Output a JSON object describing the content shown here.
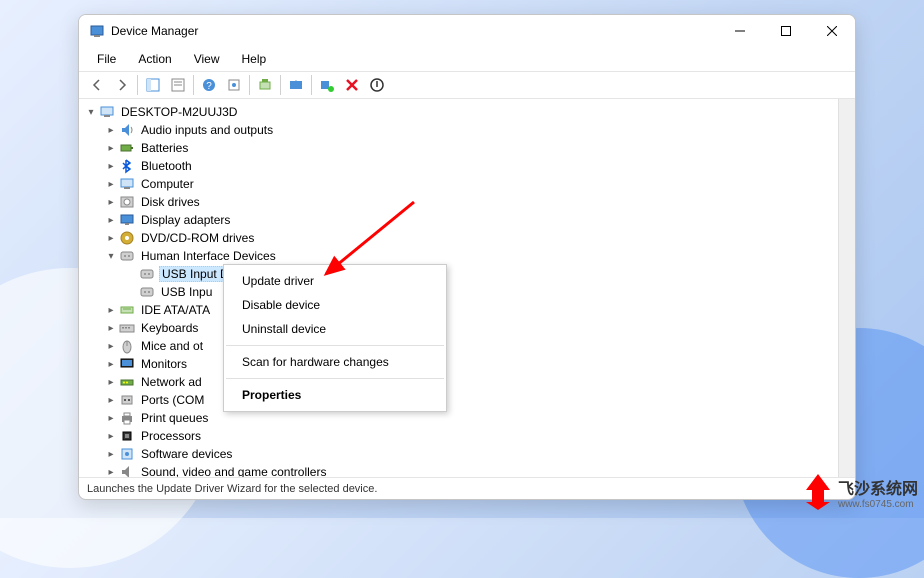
{
  "window": {
    "title": "Device Manager"
  },
  "menu": {
    "file": "File",
    "action": "Action",
    "view": "View",
    "help": "Help"
  },
  "tree": {
    "root": "DESKTOP-M2UUJ3D",
    "items": [
      {
        "label": "Audio inputs and outputs",
        "arrow": "right",
        "indent": 1,
        "icon": "audio"
      },
      {
        "label": "Batteries",
        "arrow": "right",
        "indent": 1,
        "icon": "battery"
      },
      {
        "label": "Bluetooth",
        "arrow": "right",
        "indent": 1,
        "icon": "bluetooth"
      },
      {
        "label": "Computer",
        "arrow": "right",
        "indent": 1,
        "icon": "computer"
      },
      {
        "label": "Disk drives",
        "arrow": "right",
        "indent": 1,
        "icon": "disk"
      },
      {
        "label": "Display adapters",
        "arrow": "right",
        "indent": 1,
        "icon": "display"
      },
      {
        "label": "DVD/CD-ROM drives",
        "arrow": "right",
        "indent": 1,
        "icon": "dvd"
      },
      {
        "label": "Human Interface Devices",
        "arrow": "down",
        "indent": 1,
        "icon": "hid"
      },
      {
        "label": "USB Input Device",
        "arrow": "",
        "indent": 2,
        "icon": "hid",
        "selected": true
      },
      {
        "label": "USB Input Device",
        "arrow": "",
        "indent": 2,
        "icon": "hid",
        "truncated": "USB Inpu"
      },
      {
        "label": "IDE ATA/ATAPI controllers",
        "arrow": "right",
        "indent": 1,
        "icon": "ide",
        "truncated": "IDE ATA/ATA"
      },
      {
        "label": "Keyboards",
        "arrow": "right",
        "indent": 1,
        "icon": "keyboard"
      },
      {
        "label": "Mice and other pointing devices",
        "arrow": "right",
        "indent": 1,
        "icon": "mouse",
        "truncated": "Mice and ot"
      },
      {
        "label": "Monitors",
        "arrow": "right",
        "indent": 1,
        "icon": "monitor"
      },
      {
        "label": "Network adapters",
        "arrow": "right",
        "indent": 1,
        "icon": "network",
        "truncated": "Network ad"
      },
      {
        "label": "Ports (COM & LPT)",
        "arrow": "right",
        "indent": 1,
        "icon": "port",
        "truncated": "Ports (COM"
      },
      {
        "label": "Print queues",
        "arrow": "right",
        "indent": 1,
        "icon": "printer"
      },
      {
        "label": "Processors",
        "arrow": "right",
        "indent": 1,
        "icon": "cpu"
      },
      {
        "label": "Software devices",
        "arrow": "right",
        "indent": 1,
        "icon": "software"
      },
      {
        "label": "Sound, video and game controllers",
        "arrow": "right",
        "indent": 1,
        "icon": "sound"
      }
    ]
  },
  "context_menu": {
    "update": "Update driver",
    "disable": "Disable device",
    "uninstall": "Uninstall device",
    "scan": "Scan for hardware changes",
    "properties": "Properties"
  },
  "statusbar": "Launches the Update Driver Wizard for the selected device.",
  "watermark": {
    "main": "飞沙系统网",
    "sub": "www.fs0745.com"
  }
}
